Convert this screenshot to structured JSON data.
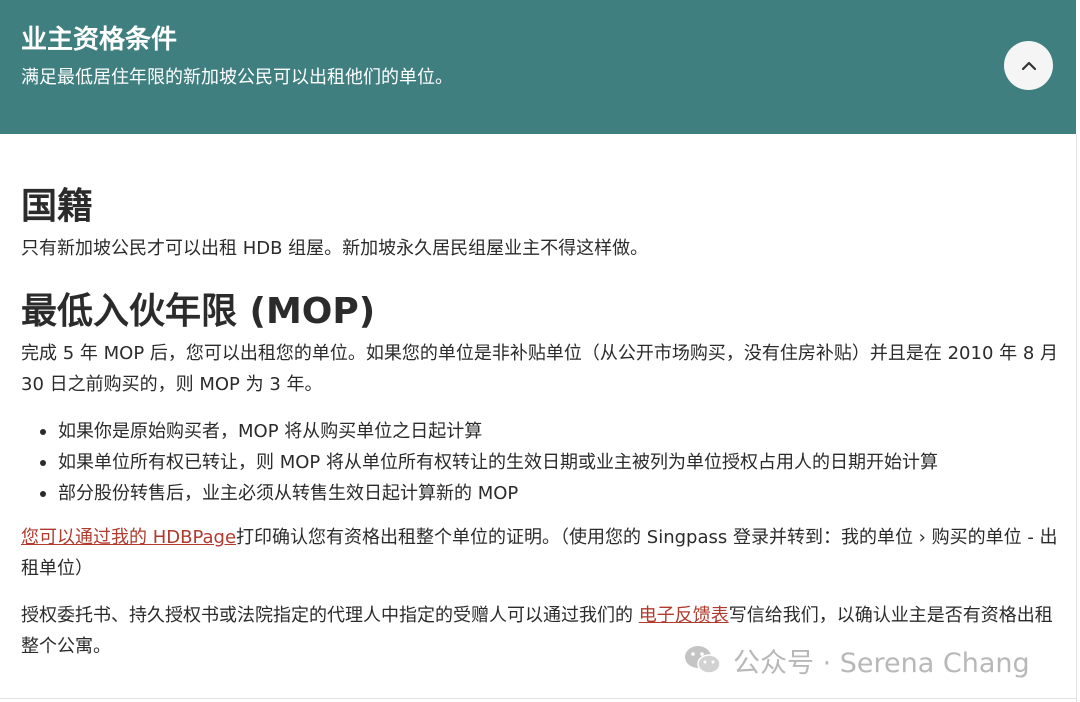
{
  "header": {
    "title": "业主资格条件",
    "subtitle": "满足最低居住年限的新加坡公民可以出租他们的单位。",
    "collapse_icon": "chevron-up-icon",
    "background_color": "#3f7f80"
  },
  "nationality": {
    "title": "国籍",
    "text": "只有新加坡公民才可以出租 HDB 组屋。新加坡永久居民组屋业主不得这样做。"
  },
  "mop": {
    "title": "最低入伙年限 (MOP)",
    "text": "完成 5 年 MOP 后，您可以出租您的单位。如果您的单位是非补贴单位（从公开市场购买，没有住房补贴）并且是在 2010 年 8 月 30 日之前购买的，则 MOP 为 3 年。",
    "bullets": [
      "如果你是原始购买者，MOP 将从购买单位之日起计算",
      "如果单位所有权已转让，则 MOP 将从单位所有权转让的生效日期或业主被列为单位授权占用人的日期开始计算",
      "部分股份转售后，业主必须从转售生效日起计算新的 MOP"
    ]
  },
  "print_para": {
    "link": "您可以通过我的 HDBPage",
    "text": "打印确认您有资格出租整个单位的证明。（使用您的 Singpass 登录并转到：我的单位 › 购买的单位 - 出租单位）"
  },
  "poa_para": {
    "text_before": "授权委托书、持久授权书或法院指定的代理人中指定的受赠人可以通过我们的 ",
    "link": "电子反馈表",
    "text_after": "写信给我们，以确认业主是否有资格出租整个公寓。"
  },
  "watermark": {
    "text": "公众号 · Serena Chang",
    "icon": "wechat-icon"
  },
  "colors": {
    "link": "#b03a2e",
    "text": "#2b2b2b"
  }
}
